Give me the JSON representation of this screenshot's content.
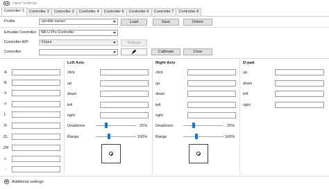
{
  "window": {
    "title": "Input Settings"
  },
  "tabs": [
    "Controller 1",
    "Controller 2",
    "Controller 3",
    "Controller 4",
    "Controller 5",
    "Controller 6",
    "Controller 7",
    "Controller 8"
  ],
  "profile": {
    "label": "Profile",
    "value": "<profile name>",
    "load": "Load",
    "save": "Save",
    "delete": "Delete"
  },
  "emulate": {
    "label": "Emulate Controller",
    "value": "Wii U Pro Controller"
  },
  "api": {
    "label": "Controller API:",
    "value": "XInput",
    "settings": "Settings"
  },
  "controller": {
    "label": "Controller:",
    "value": "",
    "calibrate": "Calibrate",
    "clear": "Clear"
  },
  "buttons": [
    "A",
    "B",
    "X",
    "Y",
    "L",
    "R",
    "ZL",
    "ZR",
    "+",
    "-"
  ],
  "left_axis": {
    "title": "Left Axis",
    "rows": [
      "click",
      "up",
      "down",
      "left",
      "right"
    ],
    "deadzone_label": "Deadzone",
    "deadzone_value": "25%",
    "deadzone_level": 0.25,
    "range_label": "Range",
    "range_value": "100%",
    "range_level": 0.33
  },
  "right_axis": {
    "title": "Right Axis",
    "rows": [
      "click",
      "up",
      "down",
      "left",
      "right"
    ],
    "deadzone_label": "Deadzone",
    "deadzone_value": "25%",
    "deadzone_level": 0.25,
    "range_label": "Range",
    "range_value": "100%",
    "range_level": 0.33
  },
  "dpad": {
    "title": "D-pad",
    "rows": [
      "up",
      "down",
      "left",
      "right"
    ]
  },
  "footer": {
    "additional": "Additional settings"
  },
  "colors": {
    "accent": "#0078d7"
  }
}
